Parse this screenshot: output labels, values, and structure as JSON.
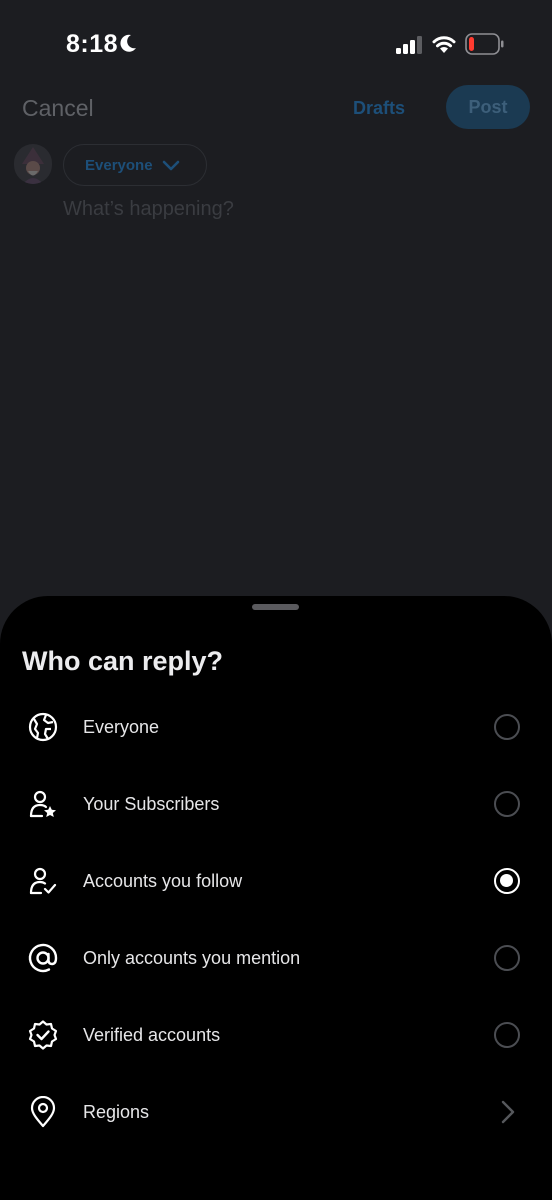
{
  "status_bar": {
    "time": "8:18",
    "focus_icon": "moon-icon",
    "signal_icon": "cellular-signal-icon",
    "wifi_icon": "wifi-icon",
    "battery_icon": "battery-low-icon",
    "battery_color": "#ff3b30"
  },
  "compose": {
    "cancel_label": "Cancel",
    "drafts_label": "Drafts",
    "post_label": "Post",
    "audience_label": "Everyone",
    "input_placeholder": "What’s happening?",
    "accent": "#1d9bf0"
  },
  "reply_sheet": {
    "title": "Who can reply?",
    "options": [
      {
        "label": "Everyone",
        "icon": "globe-icon",
        "control": "radio",
        "selected": false
      },
      {
        "label": "Your Subscribers",
        "icon": "person-star-icon",
        "control": "radio",
        "selected": false
      },
      {
        "label": "Accounts you follow",
        "icon": "person-check-icon",
        "control": "radio",
        "selected": true
      },
      {
        "label": "Only accounts you mention",
        "icon": "at-sign-icon",
        "control": "radio",
        "selected": false
      },
      {
        "label": "Verified accounts",
        "icon": "verified-badge-icon",
        "control": "radio",
        "selected": false
      },
      {
        "label": "Regions",
        "icon": "location-pin-icon",
        "control": "chevron",
        "selected": false
      }
    ]
  }
}
